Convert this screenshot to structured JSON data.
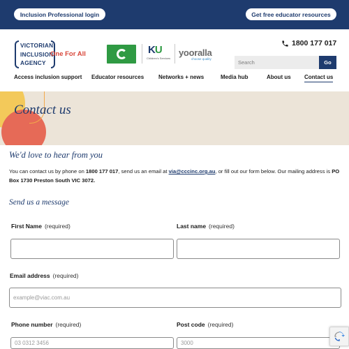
{
  "topbar": {
    "login_label": "Inclusion Professional login",
    "resources_label": "Get free educator resources"
  },
  "header": {
    "logo": {
      "line1": "VICTORIAN",
      "line2": "INCLUSION",
      "line3": "AGENCY",
      "tagline": "One For All"
    },
    "partners": {
      "ku_sub": "Children's Services",
      "yooralla": "yooralla",
      "yooralla_sub": "choose quality"
    },
    "phone": "1800 177 017",
    "search": {
      "placeholder": "Search",
      "button": "Go"
    }
  },
  "nav": {
    "items": [
      {
        "label": "Access inclusion support"
      },
      {
        "label": "Educator resources"
      },
      {
        "label": "Networks + news"
      },
      {
        "label": "Media hub"
      },
      {
        "label": "About us"
      },
      {
        "label": "Contact us",
        "active": true
      }
    ]
  },
  "banner": {
    "title": "Contact us"
  },
  "content": {
    "heading": "We'd love to hear from you",
    "intro_1": "You can contact us by phone on ",
    "intro_phone": "1800 177 017",
    "intro_2": ", send us an email at ",
    "intro_email": "via@cccinc.org.au",
    "intro_3": ", or fill out our form below. Our mailing address is ",
    "intro_address": "PO Box 1730 Preston South VIC 3072.",
    "form_heading": "Send us a message"
  },
  "form": {
    "required_text": "(required)",
    "first_name": {
      "label": "First Name",
      "value": ""
    },
    "last_name": {
      "label": "Last name",
      "value": ""
    },
    "email": {
      "label": "Email address",
      "placeholder": "example@viac.com.au"
    },
    "phone": {
      "label": "Phone number",
      "placeholder": "03 0312 3456"
    },
    "postcode": {
      "label": "Post code",
      "placeholder": "3000"
    }
  },
  "colors": {
    "navy": "#1e3b6e",
    "banner_bg": "#ece4d8",
    "accent_red": "#e66a57",
    "accent_yellow": "#f3c95a",
    "green": "#2f9a43"
  }
}
